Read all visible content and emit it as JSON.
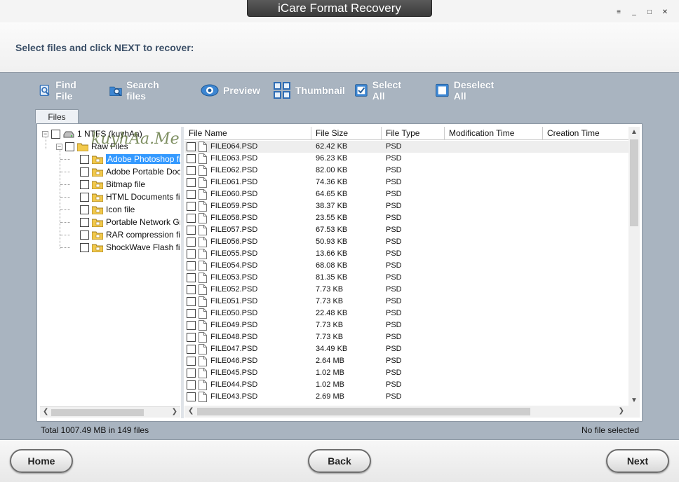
{
  "window": {
    "title": "iCare Format Recovery",
    "controls": {
      "menu": "≡",
      "minimize": "_",
      "maximize": "□",
      "close": "✕"
    }
  },
  "header": {
    "instruction": "Select files and click NEXT to recover:"
  },
  "toolbar": [
    {
      "label": "Find File",
      "icon": "find-file-icon"
    },
    {
      "label": "Search files",
      "icon": "search-files-icon"
    },
    {
      "label": "Preview",
      "icon": "preview-eye-icon"
    },
    {
      "label": "Thumbnail",
      "icon": "thumbnail-grid-icon"
    },
    {
      "label": "Select All",
      "icon": "select-all-icon"
    },
    {
      "label": "Deselect All",
      "icon": "deselect-all-icon"
    }
  ],
  "tabs": [
    {
      "label": "Files"
    }
  ],
  "tree": {
    "root": {
      "label": "1 NTFS (kuyhAa)"
    },
    "child": {
      "label": "Raw Files"
    },
    "items": [
      {
        "label": "Adobe Photoshop fi"
      },
      {
        "label": "Adobe Portable Doc"
      },
      {
        "label": "Bitmap file"
      },
      {
        "label": "HTML Documents fi"
      },
      {
        "label": "Icon file"
      },
      {
        "label": "Portable Network Gr"
      },
      {
        "label": "RAR compression fil"
      },
      {
        "label": "ShockWave Flash file"
      }
    ]
  },
  "watermark": "kuyhAa.Me",
  "columns": [
    "File Name",
    "File Size",
    "File Type",
    "Modification Time",
    "Creation Time"
  ],
  "files": [
    {
      "name": "FILE064.PSD",
      "size": "62.42 KB",
      "type": "PSD"
    },
    {
      "name": "FILE063.PSD",
      "size": "96.23 KB",
      "type": "PSD"
    },
    {
      "name": "FILE062.PSD",
      "size": "82.00 KB",
      "type": "PSD"
    },
    {
      "name": "FILE061.PSD",
      "size": "74.36 KB",
      "type": "PSD"
    },
    {
      "name": "FILE060.PSD",
      "size": "64.65 KB",
      "type": "PSD"
    },
    {
      "name": "FILE059.PSD",
      "size": "38.37 KB",
      "type": "PSD"
    },
    {
      "name": "FILE058.PSD",
      "size": "23.55 KB",
      "type": "PSD"
    },
    {
      "name": "FILE057.PSD",
      "size": "67.53 KB",
      "type": "PSD"
    },
    {
      "name": "FILE056.PSD",
      "size": "50.93 KB",
      "type": "PSD"
    },
    {
      "name": "FILE055.PSD",
      "size": "13.66 KB",
      "type": "PSD"
    },
    {
      "name": "FILE054.PSD",
      "size": "68.08 KB",
      "type": "PSD"
    },
    {
      "name": "FILE053.PSD",
      "size": "81.35 KB",
      "type": "PSD"
    },
    {
      "name": "FILE052.PSD",
      "size": "7.73 KB",
      "type": "PSD"
    },
    {
      "name": "FILE051.PSD",
      "size": "7.73 KB",
      "type": "PSD"
    },
    {
      "name": "FILE050.PSD",
      "size": "22.48 KB",
      "type": "PSD"
    },
    {
      "name": "FILE049.PSD",
      "size": "7.73 KB",
      "type": "PSD"
    },
    {
      "name": "FILE048.PSD",
      "size": "7.73 KB",
      "type": "PSD"
    },
    {
      "name": "FILE047.PSD",
      "size": "34.49 KB",
      "type": "PSD"
    },
    {
      "name": "FILE046.PSD",
      "size": "2.64 MB",
      "type": "PSD"
    },
    {
      "name": "FILE045.PSD",
      "size": "1.02 MB",
      "type": "PSD"
    },
    {
      "name": "FILE044.PSD",
      "size": "1.02 MB",
      "type": "PSD"
    },
    {
      "name": "FILE043.PSD",
      "size": "2.69 MB",
      "type": "PSD"
    }
  ],
  "status": {
    "total": "Total 1007.49 MB in 149 files",
    "selection": "No file selected"
  },
  "footer": {
    "home": "Home",
    "back": "Back",
    "next": "Next"
  },
  "colors": {
    "toolbar_text": "#ffffff",
    "background": "#a9b4c0",
    "selection": "#3399ff",
    "header_text": "#3b4f67"
  }
}
